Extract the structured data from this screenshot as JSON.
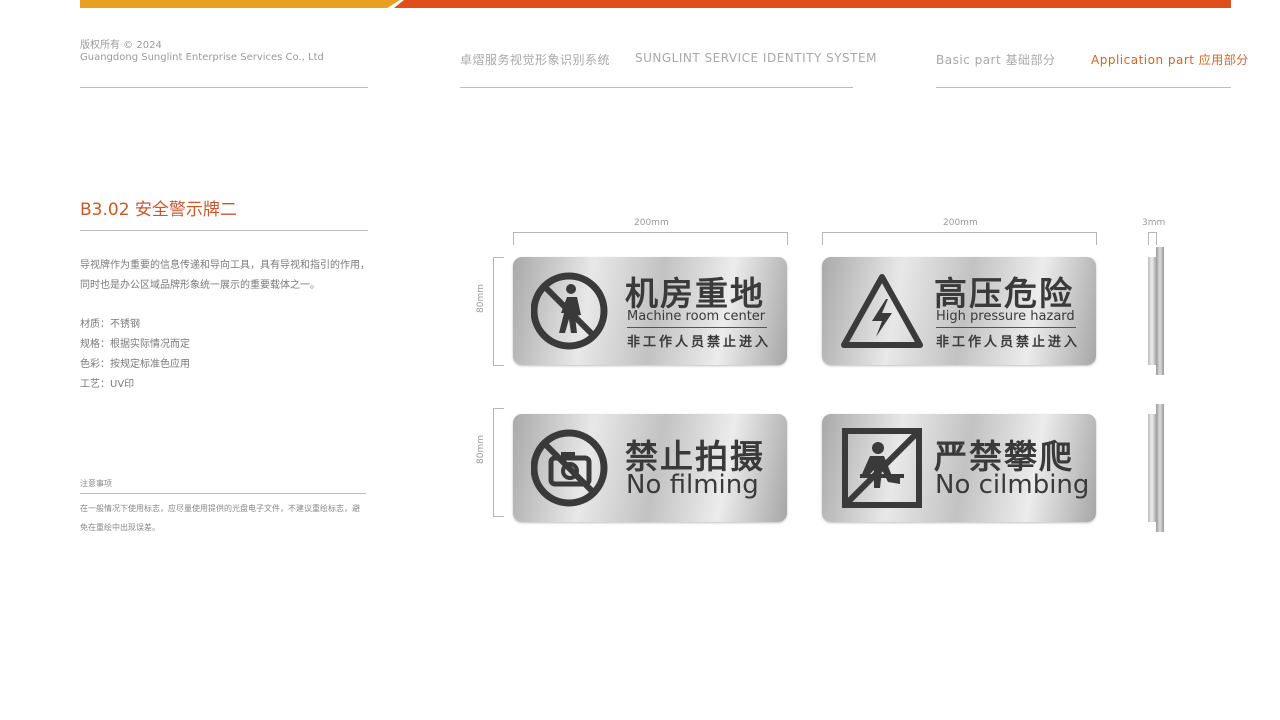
{
  "header": {
    "copyright": "版权所有 © 2024",
    "company": "Guangdong Sunglint Enterprise Services Co., Ltd",
    "system_cn": "卓熠服务视觉形象识别系统",
    "system_en": "SUNGLINT SERVICE IDENTITY SYSTEM",
    "nav_basic": "Basic part 基础部分",
    "nav_application": "Application part 应用部分"
  },
  "colors": {
    "accent": "#c8582a",
    "bar_orange": "#e04e1b",
    "bar_yellow": "#e8a020",
    "sign_text": "#3a3a3a"
  },
  "section": {
    "title": "B3.02 安全警示牌二",
    "desc_lines": [
      "导视牌作为重要的信息传递和导向工具，具有导视和指引的作用，",
      "同时也是办公区域品牌形象统一展示的重要载体之一。"
    ],
    "specs": [
      "材质：不锈钢",
      "规格：根据实际情况而定",
      "色彩：按规定标准色应用",
      "工艺：UV印"
    ],
    "note_title": "注意事项",
    "note_lines": [
      "在一般情况下使用标志，应尽量使用提供的光盘电子文件，不建议重绘标志，避",
      "免在重绘中出现误差。"
    ]
  },
  "dimensions": {
    "width1": "200mm",
    "width2": "200mm",
    "thickness": "3mm",
    "height1": "80mm",
    "height2": "80mm"
  },
  "signs": [
    {
      "icon": "no-pedestrian-icon",
      "title_cn": "机房重地",
      "title_en": "Machine room center",
      "sub_cn": "非工作人员禁止进入"
    },
    {
      "icon": "high-voltage-icon",
      "title_cn": "高压危险",
      "title_en": "High pressure hazard",
      "sub_cn": "非工作人员禁止进入"
    },
    {
      "icon": "no-camera-icon",
      "title_cn": "禁止拍摄",
      "title_en": "No filming"
    },
    {
      "icon": "no-climbing-icon",
      "title_cn": "严禁攀爬",
      "title_en": "No cilmbing"
    }
  ]
}
